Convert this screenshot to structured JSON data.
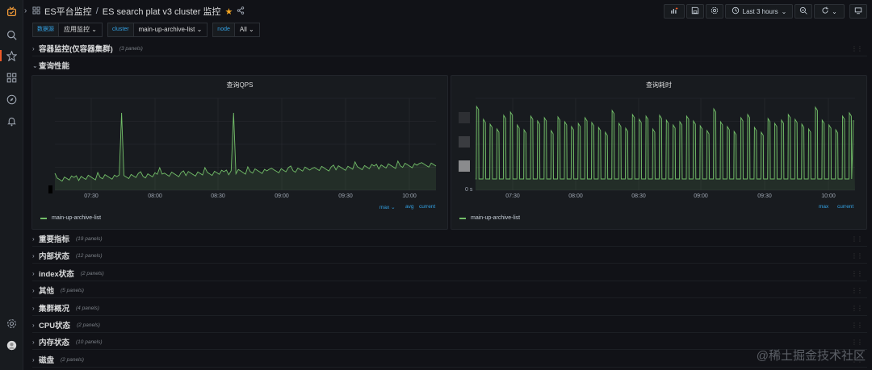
{
  "dashboard": {
    "folder": "ES平台监控",
    "separator": "/",
    "title": "ES search plat v3 cluster 监控",
    "time_range": "Last 3 hours"
  },
  "variables": [
    {
      "label": "数据源",
      "value": "应用监控"
    },
    {
      "label": "cluster",
      "value": "main-up-archive-list"
    },
    {
      "label": "node",
      "value": "All"
    }
  ],
  "rows_top": [
    {
      "title": "容器监控(仅容器集群)",
      "count": "(3 panels)",
      "expanded": false
    },
    {
      "title": "查询性能",
      "count": "",
      "expanded": true
    }
  ],
  "panels": [
    {
      "title": "查询QPS",
      "legend": "main-up-archive-list",
      "stat_headers": [
        "max",
        "avg",
        "current"
      ],
      "x_ticks": [
        "07:30",
        "08:00",
        "08:30",
        "09:00",
        "09:30",
        "10:00"
      ]
    },
    {
      "title": "查询耗时",
      "legend": "main-up-archive-list",
      "stat_headers": [
        "max",
        "current"
      ],
      "x_ticks": [
        "07:30",
        "08:00",
        "08:30",
        "09:00",
        "09:30",
        "10:00"
      ],
      "y_ticks": [
        "0 s"
      ]
    }
  ],
  "rows_bottom": [
    {
      "title": "重要指标",
      "count": "(19 panels)"
    },
    {
      "title": "内部状态",
      "count": "(12 panels)"
    },
    {
      "title": "index状态",
      "count": "(2 panels)"
    },
    {
      "title": "其他",
      "count": "(5 panels)"
    },
    {
      "title": "集群概况",
      "count": "(4 panels)"
    },
    {
      "title": "CPU状态",
      "count": "(2 panels)"
    },
    {
      "title": "内存状态",
      "count": "(10 panels)"
    },
    {
      "title": "磁盘",
      "count": "(2 panels)"
    }
  ],
  "watermark": "@稀土掘金技术社区",
  "colors": {
    "series": "#73bf69",
    "accent": "#33a2e5",
    "star": "#f5a623"
  },
  "icons": {
    "sidebar": [
      "grafana-logo-icon",
      "search-icon",
      "star-icon",
      "dashboards-icon",
      "explore-icon",
      "alerting-icon",
      "settings-icon",
      "avatar"
    ],
    "toolbar": [
      "add-panel-icon",
      "save-icon",
      "settings-icon",
      "clock-icon",
      "zoom-out-icon",
      "refresh-icon",
      "tv-mode-icon"
    ]
  }
}
